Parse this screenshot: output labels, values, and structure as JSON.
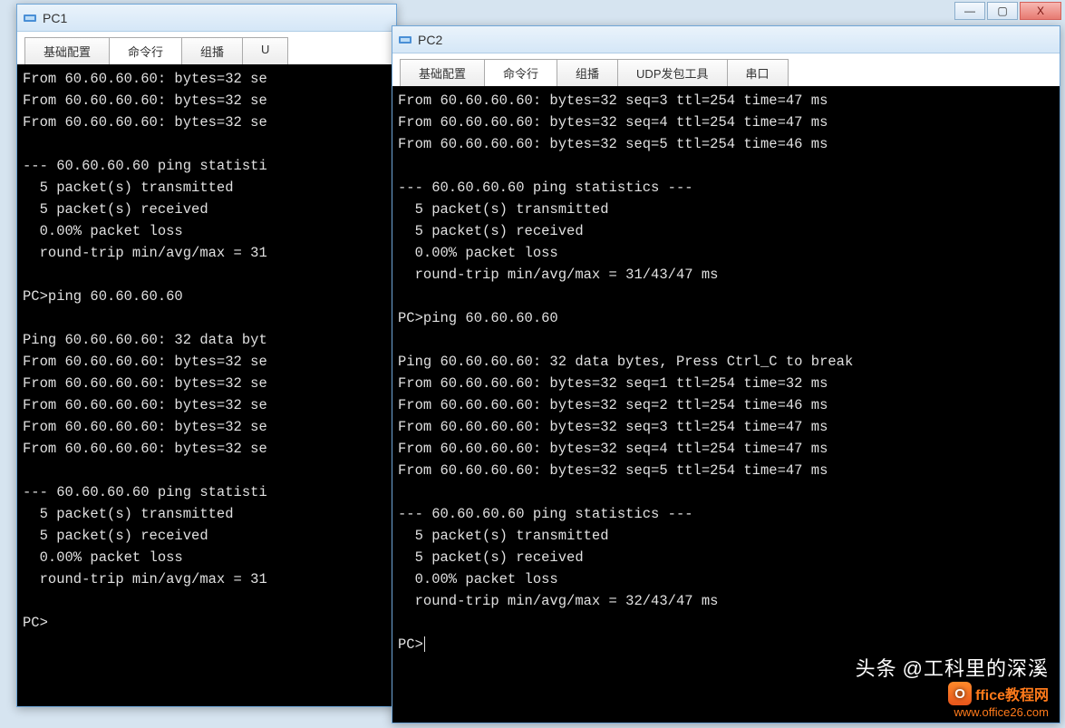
{
  "pc1": {
    "title": "PC1",
    "tabs": [
      "基础配置",
      "命令行",
      "组播",
      "U"
    ],
    "activeTab": 1,
    "lines": [
      "From 60.60.60.60: bytes=32 se",
      "From 60.60.60.60: bytes=32 se",
      "From 60.60.60.60: bytes=32 se",
      "",
      "--- 60.60.60.60 ping statisti",
      "  5 packet(s) transmitted",
      "  5 packet(s) received",
      "  0.00% packet loss",
      "  round-trip min/avg/max = 31",
      "",
      "PC>ping 60.60.60.60",
      "",
      "Ping 60.60.60.60: 32 data byt",
      "From 60.60.60.60: bytes=32 se",
      "From 60.60.60.60: bytes=32 se",
      "From 60.60.60.60: bytes=32 se",
      "From 60.60.60.60: bytes=32 se",
      "From 60.60.60.60: bytes=32 se",
      "",
      "--- 60.60.60.60 ping statisti",
      "  5 packet(s) transmitted",
      "  5 packet(s) received",
      "  0.00% packet loss",
      "  round-trip min/avg/max = 31",
      "",
      "PC>"
    ]
  },
  "pc2": {
    "title": "PC2",
    "tabs": [
      "基础配置",
      "命令行",
      "组播",
      "UDP发包工具",
      "串口"
    ],
    "activeTab": 1,
    "lines": [
      "From 60.60.60.60: bytes=32 seq=3 ttl=254 time=47 ms",
      "From 60.60.60.60: bytes=32 seq=4 ttl=254 time=47 ms",
      "From 60.60.60.60: bytes=32 seq=5 ttl=254 time=46 ms",
      "",
      "--- 60.60.60.60 ping statistics ---",
      "  5 packet(s) transmitted",
      "  5 packet(s) received",
      "  0.00% packet loss",
      "  round-trip min/avg/max = 31/43/47 ms",
      "",
      "PC>ping 60.60.60.60",
      "",
      "Ping 60.60.60.60: 32 data bytes, Press Ctrl_C to break",
      "From 60.60.60.60: bytes=32 seq=1 ttl=254 time=32 ms",
      "From 60.60.60.60: bytes=32 seq=2 ttl=254 time=46 ms",
      "From 60.60.60.60: bytes=32 seq=3 ttl=254 time=47 ms",
      "From 60.60.60.60: bytes=32 seq=4 ttl=254 time=47 ms",
      "From 60.60.60.60: bytes=32 seq=5 ttl=254 time=47 ms",
      "",
      "--- 60.60.60.60 ping statistics ---",
      "  5 packet(s) transmitted",
      "  5 packet(s) received",
      "  0.00% packet loss",
      "  round-trip min/avg/max = 32/43/47 ms",
      "",
      "PC>"
    ]
  },
  "winbuttons": {
    "min": "—",
    "max": "▢",
    "close": "X"
  },
  "watermark": {
    "line1_prefix": "头条",
    "line1_rest": "@工科里的深溪",
    "line2_badge": "O",
    "line2_text": "ffice教程网",
    "url": "www.office26.com"
  }
}
